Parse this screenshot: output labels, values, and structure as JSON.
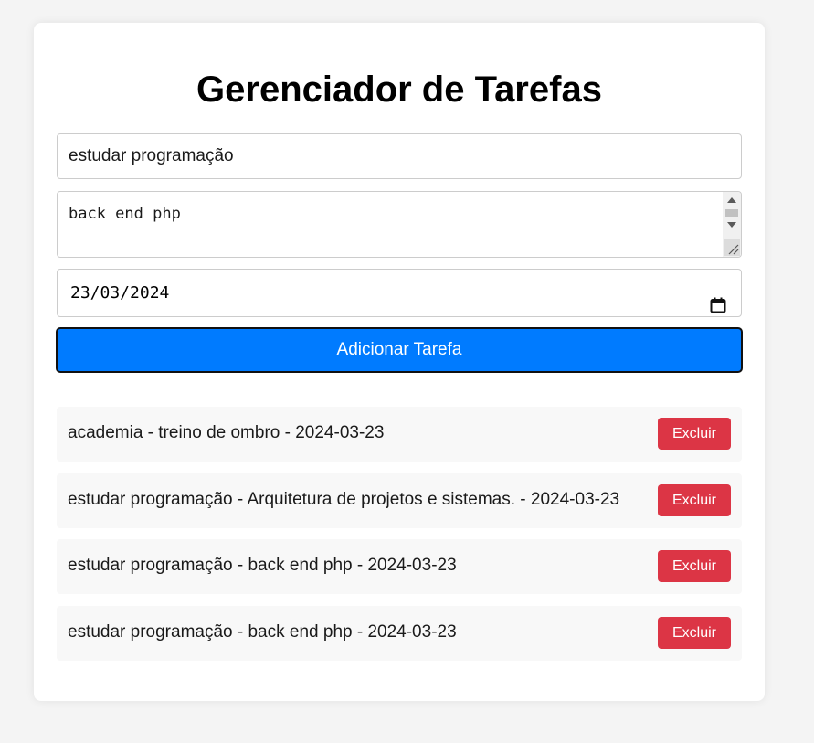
{
  "page": {
    "title": "Gerenciador de Tarefas"
  },
  "form": {
    "title_value": "estudar programação",
    "description_value": "back end php",
    "date_value": "23/03/2024",
    "add_button_label": "Adicionar Tarefa"
  },
  "tasks": [
    {
      "text": "academia - treino de ombro - 2024-03-23",
      "delete_label": "Excluir"
    },
    {
      "text": "estudar programação - Arquitetura de projetos e sistemas. - 2024-03-23",
      "delete_label": "Excluir"
    },
    {
      "text": "estudar programação - back end php - 2024-03-23",
      "delete_label": "Excluir"
    },
    {
      "text": "estudar programação - back end php - 2024-03-23",
      "delete_label": "Excluir"
    }
  ],
  "colors": {
    "primary": "#007bff",
    "danger": "#dc3545",
    "background": "#f4f4f4",
    "card": "#ffffff",
    "task_background": "#f8f8f8"
  },
  "icons": {
    "date_picker": "calendar-icon",
    "textarea_resize": "resize-grip-icon"
  }
}
